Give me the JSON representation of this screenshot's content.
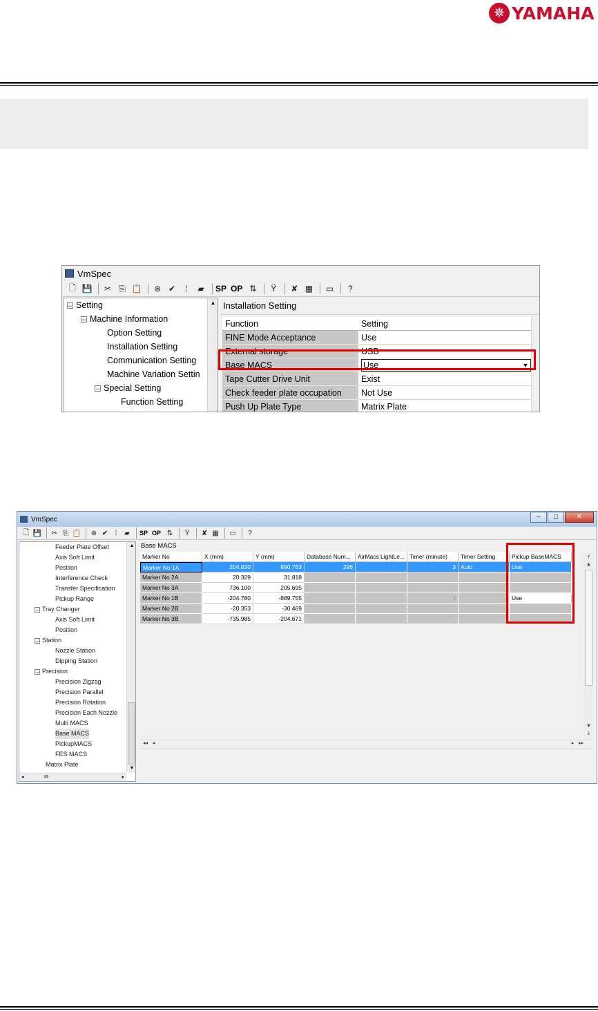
{
  "header": {
    "brand": "YAMAHA",
    "brand_color": "#c8102e"
  },
  "window1": {
    "title": "VmSpec",
    "toolbar": {
      "sp": "SP",
      "op": "OP"
    },
    "tree": [
      {
        "label": "Setting"
      },
      {
        "label": "Machine Information"
      },
      {
        "label": "Option Setting"
      },
      {
        "label": "Installation Setting"
      },
      {
        "label": "Communication Setting"
      },
      {
        "label": "Machine Variation Settin"
      },
      {
        "label": "Special Setting"
      },
      {
        "label": "Function Setting"
      }
    ],
    "panel_title": "Installation Setting",
    "columns": [
      "Function",
      "Setting"
    ],
    "rows": [
      {
        "function": "FINE Mode Acceptance",
        "setting": "Use"
      },
      {
        "function": "External storage",
        "setting": "USB"
      },
      {
        "function": "Base MACS",
        "setting": "Use"
      },
      {
        "function": "Tape Cutter Drive Unit",
        "setting": "Exist"
      },
      {
        "function": "Check feeder plate occupation",
        "setting": "Not Use"
      },
      {
        "function": "Push Up Plate Type",
        "setting": "Matrix Plate"
      }
    ],
    "highlight_color": "#e00000"
  },
  "window2": {
    "title": "VmSpec",
    "toolbar": {
      "sp": "SP",
      "op": "OP"
    },
    "tree": [
      {
        "label": "Feeder Plate Offset"
      },
      {
        "label": "Axis Soft Limit"
      },
      {
        "label": "Position"
      },
      {
        "label": "Interference Check"
      },
      {
        "label": "Transfer Specification"
      },
      {
        "label": "Pickup Range"
      },
      {
        "label": "Tray Changer"
      },
      {
        "label": "Axis Soft Limit"
      },
      {
        "label": "Position"
      },
      {
        "label": "Station"
      },
      {
        "label": "Nozzle Station"
      },
      {
        "label": "Dipping Station"
      },
      {
        "label": "Precision"
      },
      {
        "label": "Precision Zigzag"
      },
      {
        "label": "Precision Parallel"
      },
      {
        "label": "Precision Rotation"
      },
      {
        "label": "Precision Each Nozzle"
      },
      {
        "label": "Multi MACS"
      },
      {
        "label": "Base MACS"
      },
      {
        "label": "PickupMACS"
      },
      {
        "label": "FES MACS"
      },
      {
        "label": "Matrix Plate"
      }
    ],
    "panel_title": "Base MACS",
    "columns": [
      "Marker No",
      "X (mm)",
      "Y (mm)",
      "Database Num...",
      "AirMacs LightLe...",
      "Timer (minute)",
      "Timer Setting",
      "Pickup BaseMACS"
    ],
    "rows": [
      {
        "marker": "Marker No 1A",
        "x": "204.830",
        "y": "890.763",
        "db": "296",
        "air": "",
        "timer": "3",
        "timer_setting": "Auto",
        "pickup": "Use"
      },
      {
        "marker": "Marker No 2A",
        "x": "20.329",
        "y": "31.818",
        "db": "",
        "air": "",
        "timer": "",
        "timer_setting": "",
        "pickup": ""
      },
      {
        "marker": "Marker No 3A",
        "x": "736.100",
        "y": "205.695",
        "db": "",
        "air": "",
        "timer": "",
        "timer_setting": "",
        "pickup": ""
      },
      {
        "marker": "Marker No 1B",
        "x": "-204.780",
        "y": "-889.755",
        "db": "",
        "air": "",
        "timer": "3",
        "timer_setting": "",
        "pickup": "Use"
      },
      {
        "marker": "Marker No 2B",
        "x": "-20.353",
        "y": "-30.469",
        "db": "",
        "air": "",
        "timer": "",
        "timer_setting": "",
        "pickup": ""
      },
      {
        "marker": "Marker No 3B",
        "x": "-735.985",
        "y": "-204.671",
        "db": "",
        "air": "",
        "timer": "",
        "timer_setting": "",
        "pickup": ""
      }
    ],
    "selected_row_color": "#3399ff",
    "scrollbar_thumb_glyph": "III"
  }
}
